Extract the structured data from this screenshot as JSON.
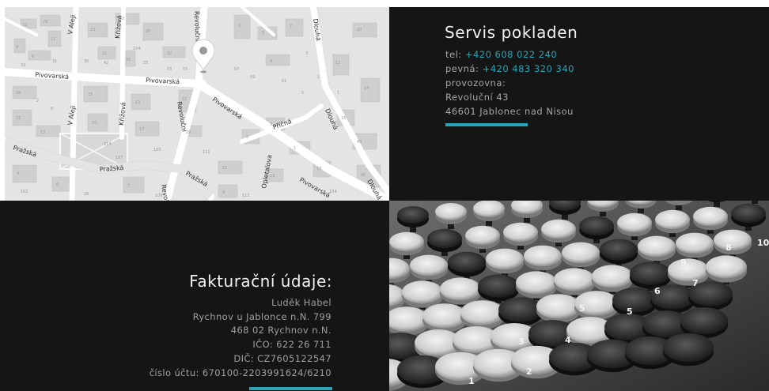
{
  "map": {
    "streets": [
      "Pivovarská",
      "Pivovarská",
      "Pivovarská",
      "Pivovarská",
      "V Aleji",
      "V Aleji",
      "Křižová",
      "Křižová",
      "Revoluční",
      "Revoluční",
      "Revoluční",
      "Dlouhá",
      "Dlouhá",
      "Dlouhá",
      "Příčná",
      "Pražská",
      "Pražská",
      "Pražská",
      "Opletalova"
    ],
    "numbers": [
      "22",
      "29",
      "4",
      "8",
      "12",
      "23",
      "21",
      "33",
      "25",
      "32",
      "154",
      "35",
      "2",
      "5",
      "7",
      "9",
      "12",
      "20",
      "14",
      "16",
      "28",
      "31",
      "13",
      "15",
      "10",
      "13",
      "17",
      "11",
      "19",
      "5",
      "3",
      "1",
      "17",
      "15",
      "13",
      "4",
      "6",
      "7",
      "9",
      "43",
      "45",
      "31",
      "33",
      "30",
      "42",
      "25",
      "53",
      "55",
      "57",
      "59",
      "61",
      "5",
      "3",
      "1",
      "1",
      "2",
      "8",
      "114",
      "105",
      "102",
      "26",
      "107",
      "109",
      "111",
      "112",
      "104"
    ]
  },
  "contact": {
    "title": "Servis pokladen",
    "tel_label": "tel:",
    "tel_value": "+420 608 022 240",
    "landline_label": "pevná:",
    "landline_value": "+420 483 320 340",
    "branch_label": "provozovna:",
    "street": "Revoluční 43",
    "city": "46601 Jablonec nad Nisou"
  },
  "billing": {
    "title": "Fakturační údaje:",
    "name": "Luděk Habel",
    "address1": "Rychnov u Jablonce n.N. 799",
    "address2": "468 02 Rychnov n.N.",
    "ico": "IČO: 622 26 711",
    "dic": "DIČ: CZ7605122547",
    "account": "číslo účtu: 670100-2203991624/6210"
  },
  "photo": {
    "key_numbers": [
      "1",
      "2",
      "3",
      "4",
      "5",
      "5",
      "6",
      "7",
      "8",
      "9",
      "10"
    ]
  },
  "colors": {
    "panel": "#151515",
    "accent": "#2aa5b5",
    "title": "#f2f2f2",
    "text": "#a8a8a8"
  },
  "icons": {
    "map_pin": "map-pin-icon"
  }
}
